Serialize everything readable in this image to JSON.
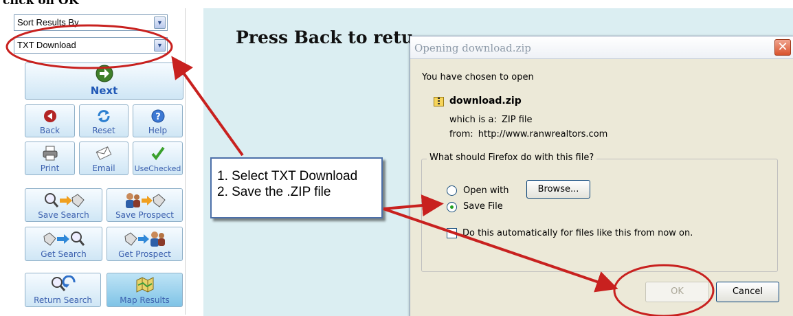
{
  "page": {
    "cutoff_heading": "click on OK",
    "press_back_text": "Press Back to retu"
  },
  "left_panel": {
    "sort_select": {
      "value": "Sort Results By"
    },
    "format_select": {
      "value": "TXT Download"
    },
    "buttons": {
      "next": "Next",
      "back": "Back",
      "reset": "Reset",
      "help": "Help",
      "print": "Print",
      "email": "Email",
      "use_checked": "UseChecked",
      "save_search": "Save Search",
      "save_prospect": "Save Prospect",
      "get_search": "Get Search",
      "get_prospect": "Get Prospect",
      "return_search": "Return Search",
      "map_results": "Map Results"
    }
  },
  "callout": {
    "line1": "1. Select TXT Download",
    "line2": "2. Save the .ZIP file"
  },
  "dialog": {
    "title": "Opening download.zip",
    "close_label": "✕",
    "intro": "You have chosen to open",
    "file_name": "download.zip",
    "which_is_label": "which is a:",
    "file_type": "ZIP file",
    "from_label": "from:",
    "from_url": "http://www.ranwrealtors.com",
    "question": "What should Firefox do with this file?",
    "open_with_label": "Open with",
    "browse_label": "Browse...",
    "save_file_label": "Save File",
    "auto_label": "Do this automatically for files like this from now on.",
    "ok_label": "OK",
    "cancel_label": "Cancel"
  },
  "colors": {
    "annotation_red": "#c8211f",
    "content_background": "#dbeef2",
    "button_text": "#3a5fae"
  }
}
